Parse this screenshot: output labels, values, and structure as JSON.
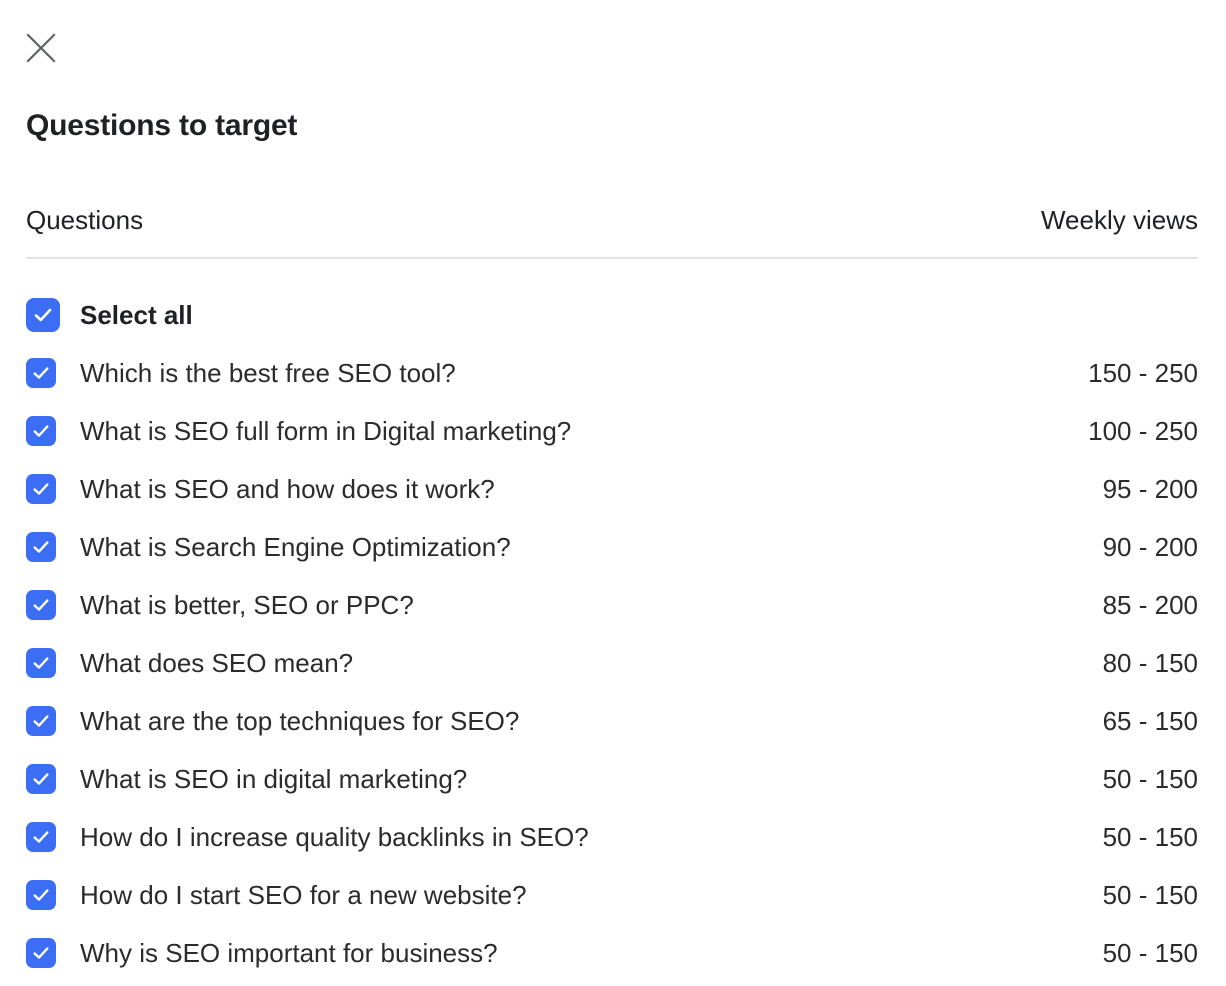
{
  "dialog": {
    "close_icon": "close-icon",
    "title": "Questions to target"
  },
  "table": {
    "header": {
      "questions": "Questions",
      "weekly_views": "Weekly views"
    },
    "select_all": {
      "label": "Select all",
      "checked": true
    },
    "rows": [
      {
        "label": "Which is the best free SEO tool?",
        "views": "150 - 250",
        "checked": true
      },
      {
        "label": "What is SEO full form in Digital marketing?",
        "views": "100 - 250",
        "checked": true
      },
      {
        "label": "What is SEO and how does it work?",
        "views": "95 - 200",
        "checked": true
      },
      {
        "label": "What is Search Engine Optimization?",
        "views": "90 - 200",
        "checked": true
      },
      {
        "label": "What is better, SEO or PPC?",
        "views": "85 - 200",
        "checked": true
      },
      {
        "label": "What does SEO mean?",
        "views": "80 - 150",
        "checked": true
      },
      {
        "label": "What are the top techniques for SEO?",
        "views": "65 - 150",
        "checked": true
      },
      {
        "label": "What is SEO in digital marketing?",
        "views": "50 - 150",
        "checked": true
      },
      {
        "label": "How do I increase quality backlinks in SEO?",
        "views": "50 - 150",
        "checked": true
      },
      {
        "label": "How do I start SEO for a new website?",
        "views": "50 - 150",
        "checked": true
      },
      {
        "label": "Why is SEO important for business?",
        "views": "50 - 150",
        "checked": true
      }
    ]
  },
  "colors": {
    "checkbox_blue": "#3b6ef5",
    "text_primary": "#202124",
    "text_row": "#2b2b2b",
    "divider": "#e3e3e3",
    "close_icon": "#5f6368",
    "background": "#ffffff"
  }
}
